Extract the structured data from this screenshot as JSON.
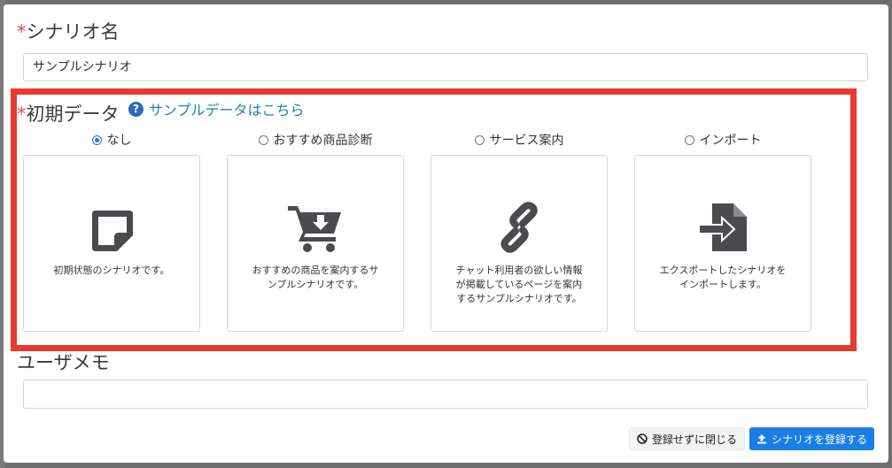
{
  "scenario_name": {
    "required_mark": "*",
    "label": "シナリオ名",
    "value": "サンプルシナリオ"
  },
  "initial_data": {
    "required_mark": "*",
    "label": "初期データ",
    "help_icon": "question-circle-icon",
    "sample_link": "サンプルデータはこちら",
    "selected": "なし",
    "options": [
      {
        "label": "なし",
        "checked": true,
        "icon": "note-icon",
        "description": "初期状態のシナリオです。"
      },
      {
        "label": "おすすめ商品診断",
        "checked": false,
        "icon": "cart-download-icon",
        "description": "おすすめの商品を案内するサ\nンプルシナリオです。"
      },
      {
        "label": "サービス案内",
        "checked": false,
        "icon": "link-icon",
        "description": "チャット利用者の欲しい情報\nが掲載しているページを案内\nするサンプルシナリオです。"
      },
      {
        "label": "インポート",
        "checked": false,
        "icon": "file-import-icon",
        "description": "エクスポートしたシナリオを\nインポートします。"
      }
    ]
  },
  "user_memo": {
    "label": "ユーザメモ",
    "value": ""
  },
  "footer": {
    "close_label": "登録せずに閉じる",
    "close_icon": "ban-icon",
    "register_label": "シナリオを登録する",
    "register_icon": "upload-icon"
  },
  "colors": {
    "required": "#d9534f",
    "highlight": "#e53a2f",
    "link": "#1f7fbf",
    "primary": "#1a7ee6",
    "icon": "#4a4a4f"
  }
}
